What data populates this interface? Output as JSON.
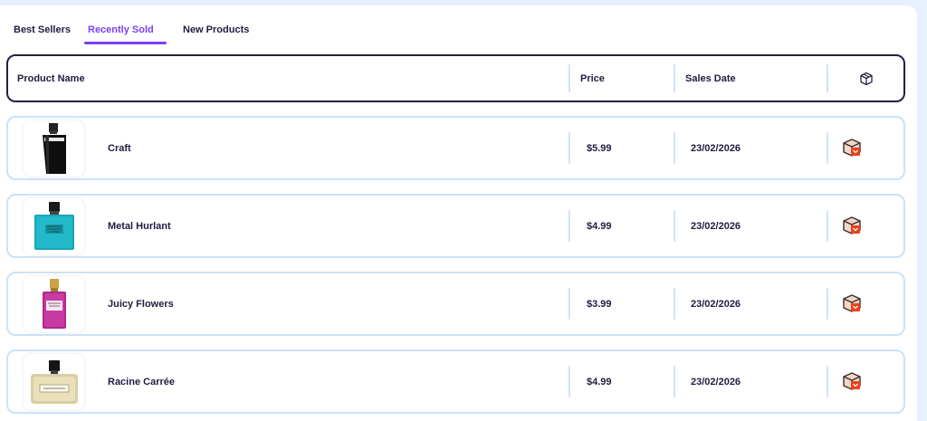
{
  "tabs": [
    {
      "label": "Best Sellers",
      "active": false
    },
    {
      "label": "Recently Sold",
      "active": true
    },
    {
      "label": "New Products",
      "active": false
    }
  ],
  "table": {
    "headers": {
      "name": "Product Name",
      "price": "Price",
      "date": "Sales Date",
      "action_icon": "box-icon"
    },
    "rows": [
      {
        "name": "Craft",
        "price": "$5.99",
        "date": "23/02/2026",
        "image": "black-perfume-bottle",
        "action_icon": "package-icon"
      },
      {
        "name": "Metal Hurlant",
        "price": "$4.99",
        "date": "23/02/2026",
        "image": "teal-perfume-bottle",
        "action_icon": "package-icon"
      },
      {
        "name": "Juicy Flowers",
        "price": "$3.99",
        "date": "23/02/2026",
        "image": "pink-perfume-bottle",
        "action_icon": "package-icon"
      },
      {
        "name": "Racine Carrée",
        "price": "$4.99",
        "date": "23/02/2026",
        "image": "gold-perfume-bottle",
        "action_icon": "package-icon"
      }
    ]
  },
  "colors": {
    "accent": "#7b3ff2",
    "text": "#1f1d3d",
    "row_border": "#cde2f6",
    "header_border": "#24203f",
    "page_bg": "#e8f1fb"
  }
}
